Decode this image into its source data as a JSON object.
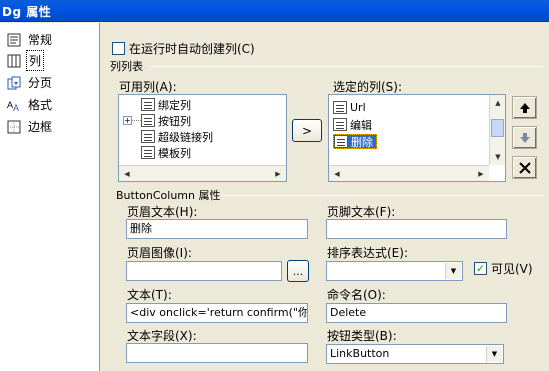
{
  "window": {
    "title": "Dg 属性"
  },
  "nav": {
    "items": [
      {
        "label": "常规",
        "icon": "general-icon"
      },
      {
        "label": "列",
        "icon": "columns-icon",
        "selected": true
      },
      {
        "label": "分页",
        "icon": "paging-icon"
      },
      {
        "label": "格式",
        "icon": "format-icon"
      },
      {
        "label": "边框",
        "icon": "borders-icon"
      }
    ]
  },
  "auto_create_label": "在运行时自动创建列(C)",
  "columns_list": {
    "group_label": "列列表",
    "available_label": "可用列(A):",
    "selected_label": "选定的列(S):",
    "available_items": [
      "绑定列",
      "按钮列",
      "超级链接列",
      "模板列"
    ],
    "selected_items": [
      "Url",
      "编辑",
      "删除"
    ],
    "add_button": ">"
  },
  "properties": {
    "group_label": "ButtonColumn 属性",
    "header_text_label": "页眉文本(H):",
    "header_text_value": "删除",
    "footer_text_label": "页脚文本(F):",
    "footer_text_value": "",
    "header_image_label": "页眉图像(I):",
    "header_image_value": "",
    "browse_button": "...",
    "sort_expr_label": "排序表达式(E):",
    "sort_expr_value": "",
    "visible_label": "可见(V)",
    "text_label": "文本(T):",
    "text_value": "<div onclick='return confirm(\"你确认",
    "command_label": "命令名(O):",
    "command_value": "Delete",
    "text_field_label": "文本字段(X):",
    "text_field_value": "",
    "button_type_label": "按钮类型(B):",
    "button_type_value": "LinkButton"
  }
}
